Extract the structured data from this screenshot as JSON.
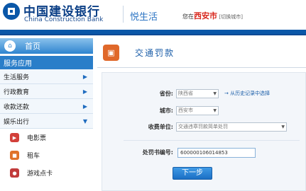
{
  "header": {
    "bank_name_cn": "中国建设银行",
    "bank_name_en": "China Construction Bank",
    "product_name": "悦生活",
    "location_prefix": "您在",
    "location_city": "西安市",
    "switch_city": "[切换城市]"
  },
  "sidebar": {
    "home_label": "首页",
    "home_icon": "⌂",
    "section_label": "服务应用",
    "menu_items": [
      {
        "label": "生活服务",
        "arrow": "▶"
      },
      {
        "label": "行政教育",
        "arrow": "▶"
      },
      {
        "label": "收款还款",
        "arrow": "▶"
      },
      {
        "label": "娱乐出行",
        "arrow": "▼"
      }
    ],
    "sub_items": [
      {
        "label": "电影票",
        "icon": "film-icon"
      },
      {
        "label": "租车",
        "icon": "car-icon"
      },
      {
        "label": "游戏点卡",
        "icon": "game-icon"
      }
    ]
  },
  "main": {
    "page_title": "交通罚款",
    "form": {
      "province_label": "省份:",
      "province_value": "陕西省",
      "history_link": "从历史记录中选择",
      "city_label": "城市:",
      "city_value": "西安市",
      "unit_label": "收费单位:",
      "unit_value": "交通违章罚款简单处罚",
      "ticket_label": "处罚书编号:",
      "ticket_value": "600000106014853"
    },
    "next_button": "下一步"
  },
  "colors": {
    "brand_blue": "#0a57a8",
    "accent_blue": "#2a7ec9",
    "city_red": "#d8271d",
    "title_icon_orange": "#e0682a"
  }
}
